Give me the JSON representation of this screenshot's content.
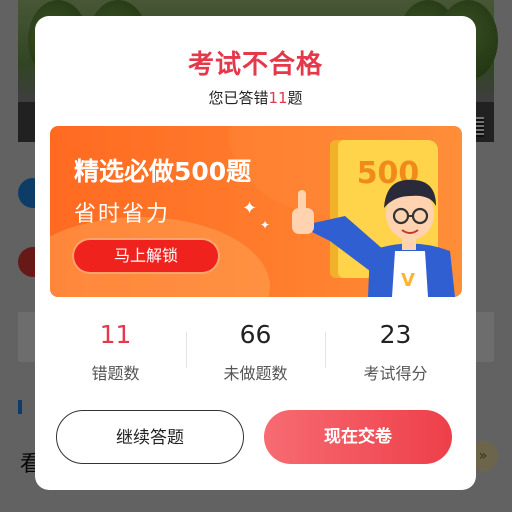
{
  "background": {
    "partial_text": "看"
  },
  "modal": {
    "title": "考试不合格",
    "subtitle_prefix": "您已答错",
    "wrong_count": "11",
    "subtitle_suffix": "题",
    "banner": {
      "title": "精选必做500题",
      "subtitle": "省时省力",
      "button_label": "马上解锁",
      "book_number": "500"
    },
    "stats": [
      {
        "value": "11",
        "label": "错题数"
      },
      {
        "value": "66",
        "label": "未做题数"
      },
      {
        "value": "23",
        "label": "考试得分"
      }
    ],
    "continue_button": "继续答题",
    "submit_button": "现在交卷"
  },
  "colors": {
    "accent_red": "#e4394b",
    "banner_orange": "#ff7b2c",
    "unlock_button_red": "#f0221e"
  }
}
